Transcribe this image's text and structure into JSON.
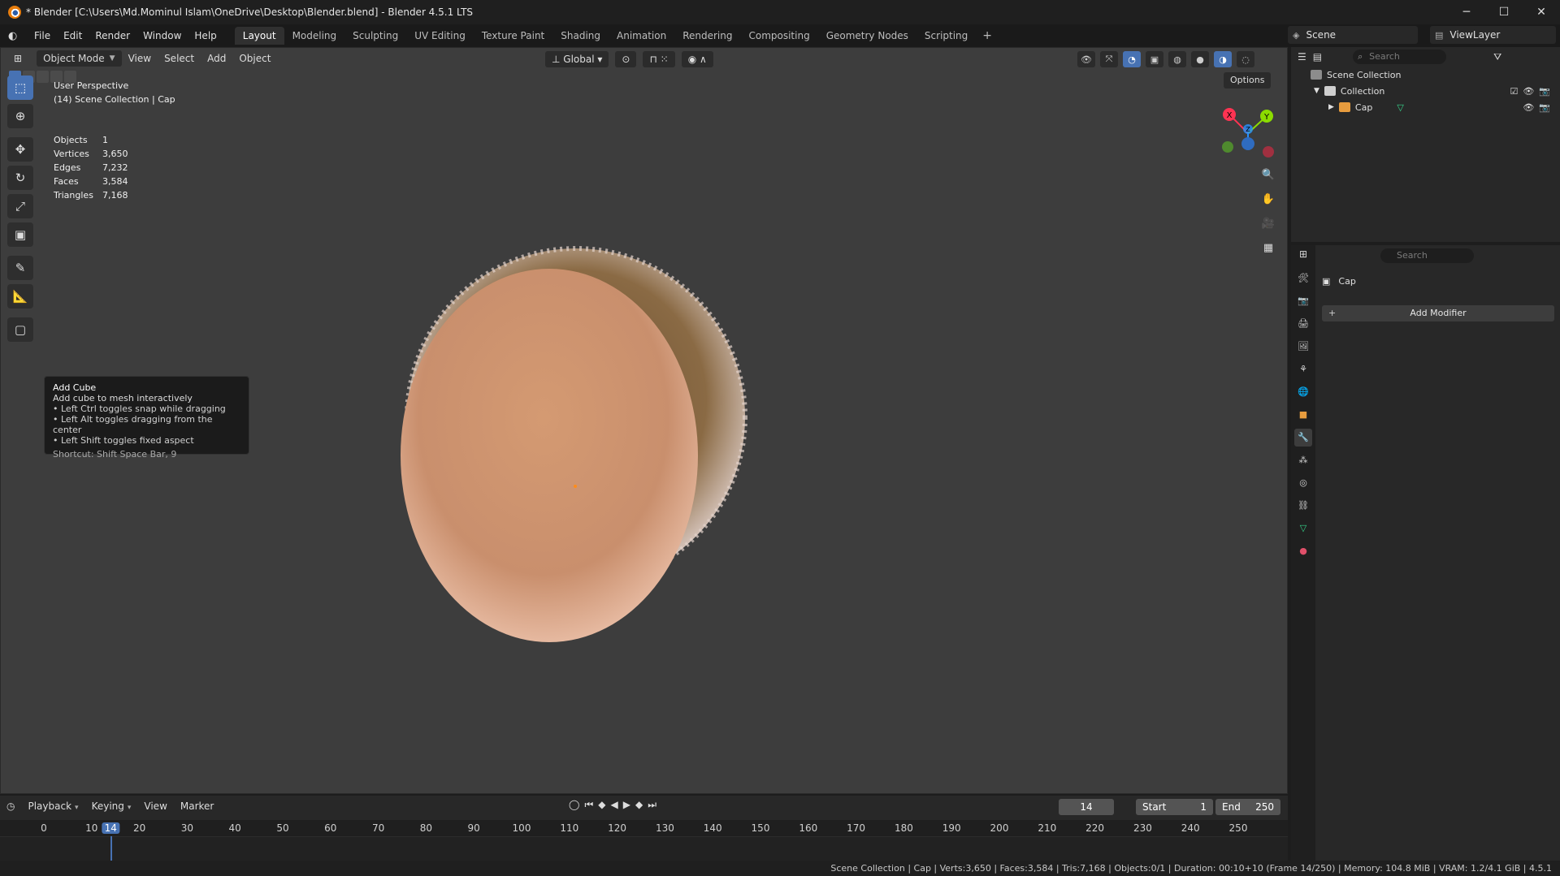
{
  "window": {
    "title": "* Blender [C:\\Users\\Md.Mominul Islam\\OneDrive\\Desktop\\Blender.blend] - Blender 4.5.1 LTS",
    "minimize": "─",
    "maximize": "☐",
    "close": "✕"
  },
  "menu": [
    "File",
    "Edit",
    "Render",
    "Window",
    "Help"
  ],
  "workspaces": [
    "Layout",
    "Modeling",
    "Sculpting",
    "UV Editing",
    "Texture Paint",
    "Shading",
    "Animation",
    "Rendering",
    "Compositing",
    "Geometry Nodes",
    "Scripting"
  ],
  "workspace_plus": "+",
  "scene": {
    "label": "Scene",
    "view_layer": "ViewLayer"
  },
  "viewport": {
    "mode": "Object Mode",
    "menus": [
      "View",
      "Select",
      "Add",
      "Object"
    ],
    "orientation": "Global",
    "options": "Options",
    "perspective": "User Perspective",
    "collection_line": "(14) Scene Collection | Cap",
    "stats": [
      {
        "k": "Objects",
        "v": "1"
      },
      {
        "k": "Vertices",
        "v": "3,650"
      },
      {
        "k": "Edges",
        "v": "7,232"
      },
      {
        "k": "Faces",
        "v": "3,584"
      },
      {
        "k": "Triangles",
        "v": "7,168"
      }
    ],
    "gizmo": {
      "x": "X",
      "y": "Y",
      "z": "Z"
    }
  },
  "tooltip": {
    "title": "Add Cube",
    "desc": "Add cube to mesh interactively",
    "items": [
      "• Left Ctrl toggles snap while dragging",
      "• Left Alt toggles dragging from the center",
      "• Left Shift toggles fixed aspect"
    ],
    "shortcut": "Shortcut: Shift Space Bar, 9"
  },
  "outliner": {
    "search": "Search",
    "root": "Scene Collection",
    "collection": "Collection",
    "object": "Cap"
  },
  "properties": {
    "search": "Search",
    "object": "Cap",
    "add_modifier": "Add Modifier"
  },
  "timeline": {
    "menus": [
      "Playback",
      "Keying",
      "View",
      "Marker"
    ],
    "current": "14",
    "start_label": "Start",
    "start": "1",
    "end_label": "End",
    "end": "250",
    "ticks": [
      "0",
      "10",
      "14",
      "20",
      "30",
      "40",
      "50",
      "60",
      "70",
      "80",
      "90",
      "100",
      "110",
      "120",
      "130",
      "140",
      "150",
      "160",
      "170",
      "180",
      "190",
      "200",
      "210",
      "220",
      "230",
      "240",
      "250"
    ]
  },
  "status": "Scene Collection | Cap | Verts:3,650 | Faces:3,584 | Tris:7,168 | Objects:0/1 | Duration: 00:10+10 (Frame 14/250) | Memory: 104.8 MiB | VRAM: 1.2/4.1 GiB | 4.5.1",
  "colors": {
    "accent": "#4772b3",
    "viewport_bg": "#3d3d3d",
    "mesh": "#d99a78"
  }
}
